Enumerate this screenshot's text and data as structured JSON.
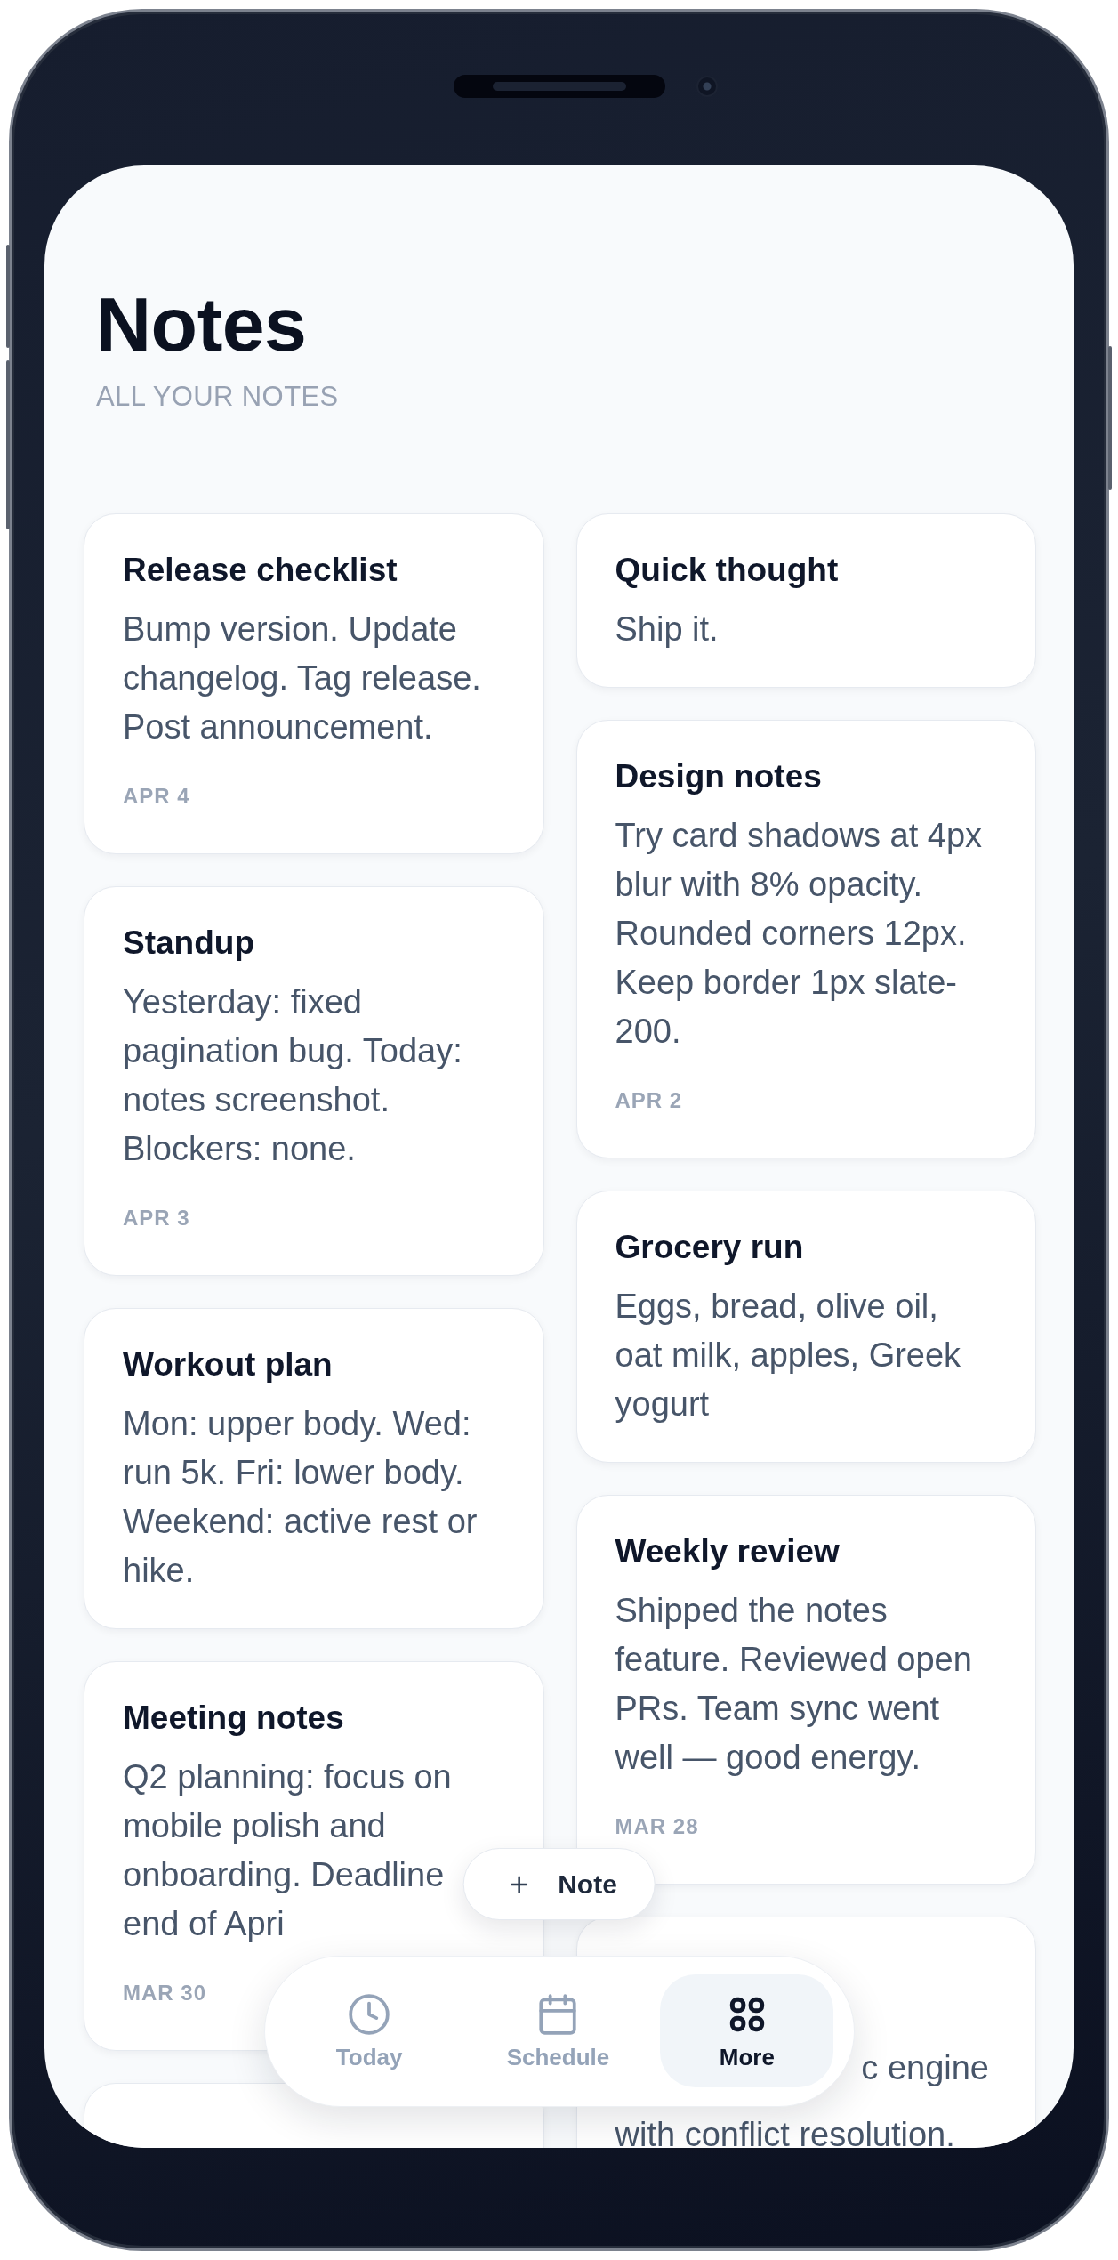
{
  "header": {
    "title": "Notes",
    "subtitle": "ALL YOUR NOTES"
  },
  "columns": [
    {
      "notes": [
        {
          "title": "Release checklist",
          "body": "Bump version. Update changelog. Tag release. Post announcement.",
          "date": "APR 4"
        },
        {
          "title": "Standup",
          "body": "Yesterday: fixed pagination bug. Today: notes screenshot. Blockers: none.",
          "date": "APR 3"
        },
        {
          "title": "Workout plan",
          "body": "Mon: upper body. Wed: run 5k. Fri: lower body. Weekend: active rest or hike."
        },
        {
          "title": "Meeting notes",
          "body": "Q2 planning: focus on mobile polish and onboarding. Deadline end of Apri",
          "date": "MAR 30"
        }
      ],
      "more_below": true
    },
    {
      "notes": [
        {
          "title": "Quick thought",
          "body": "Ship it."
        },
        {
          "title": "Design notes",
          "body": "Try card shadows at 4px blur with 8% opacity. Rounded corners 12px. Keep border 1px slate-200.",
          "date": "APR 2"
        },
        {
          "title": "Grocery run",
          "body": "Eggs, bread, olive oil, oat milk, apples, Greek yogurt"
        },
        {
          "title": "Weekly review",
          "body": "Shipped the notes feature. Reviewed open PRs. Team sync went well — good energy.",
          "date": "MAR 28"
        },
        {
          "fragments": [
            "c engine",
            "with conflict resolution."
          ]
        }
      ]
    }
  ],
  "new_note_button": {
    "label": "Note"
  },
  "bottom_nav": {
    "items": [
      {
        "label": "Today",
        "selected": false
      },
      {
        "label": "Schedule",
        "selected": false
      },
      {
        "label": "More",
        "selected": true
      }
    ]
  }
}
